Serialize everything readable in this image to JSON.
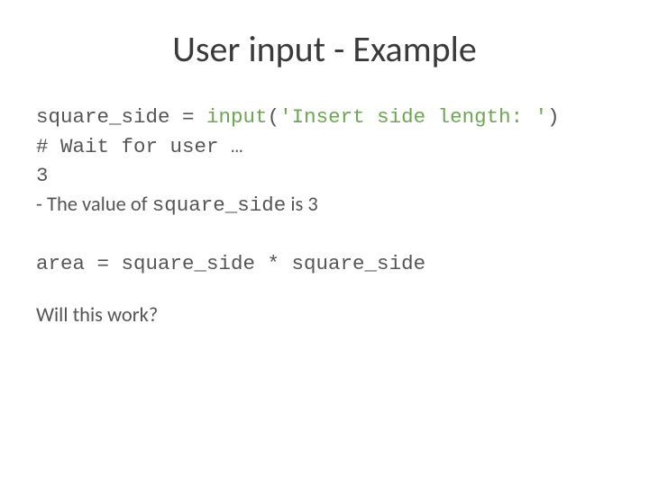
{
  "title": "User input - Example",
  "code": {
    "line1": {
      "var": "square_side",
      "eq": " = ",
      "func": "input",
      "paren_open": "(",
      "str": "'Insert side length: '",
      "paren_close": ")"
    },
    "line2": "# Wait for user …",
    "line3": "3",
    "line4": {
      "prefix": "- The value of ",
      "var": "square_side",
      "suffix": "  is 3"
    },
    "line5": "area = square_side * square_side",
    "line6": "Will this work?"
  }
}
